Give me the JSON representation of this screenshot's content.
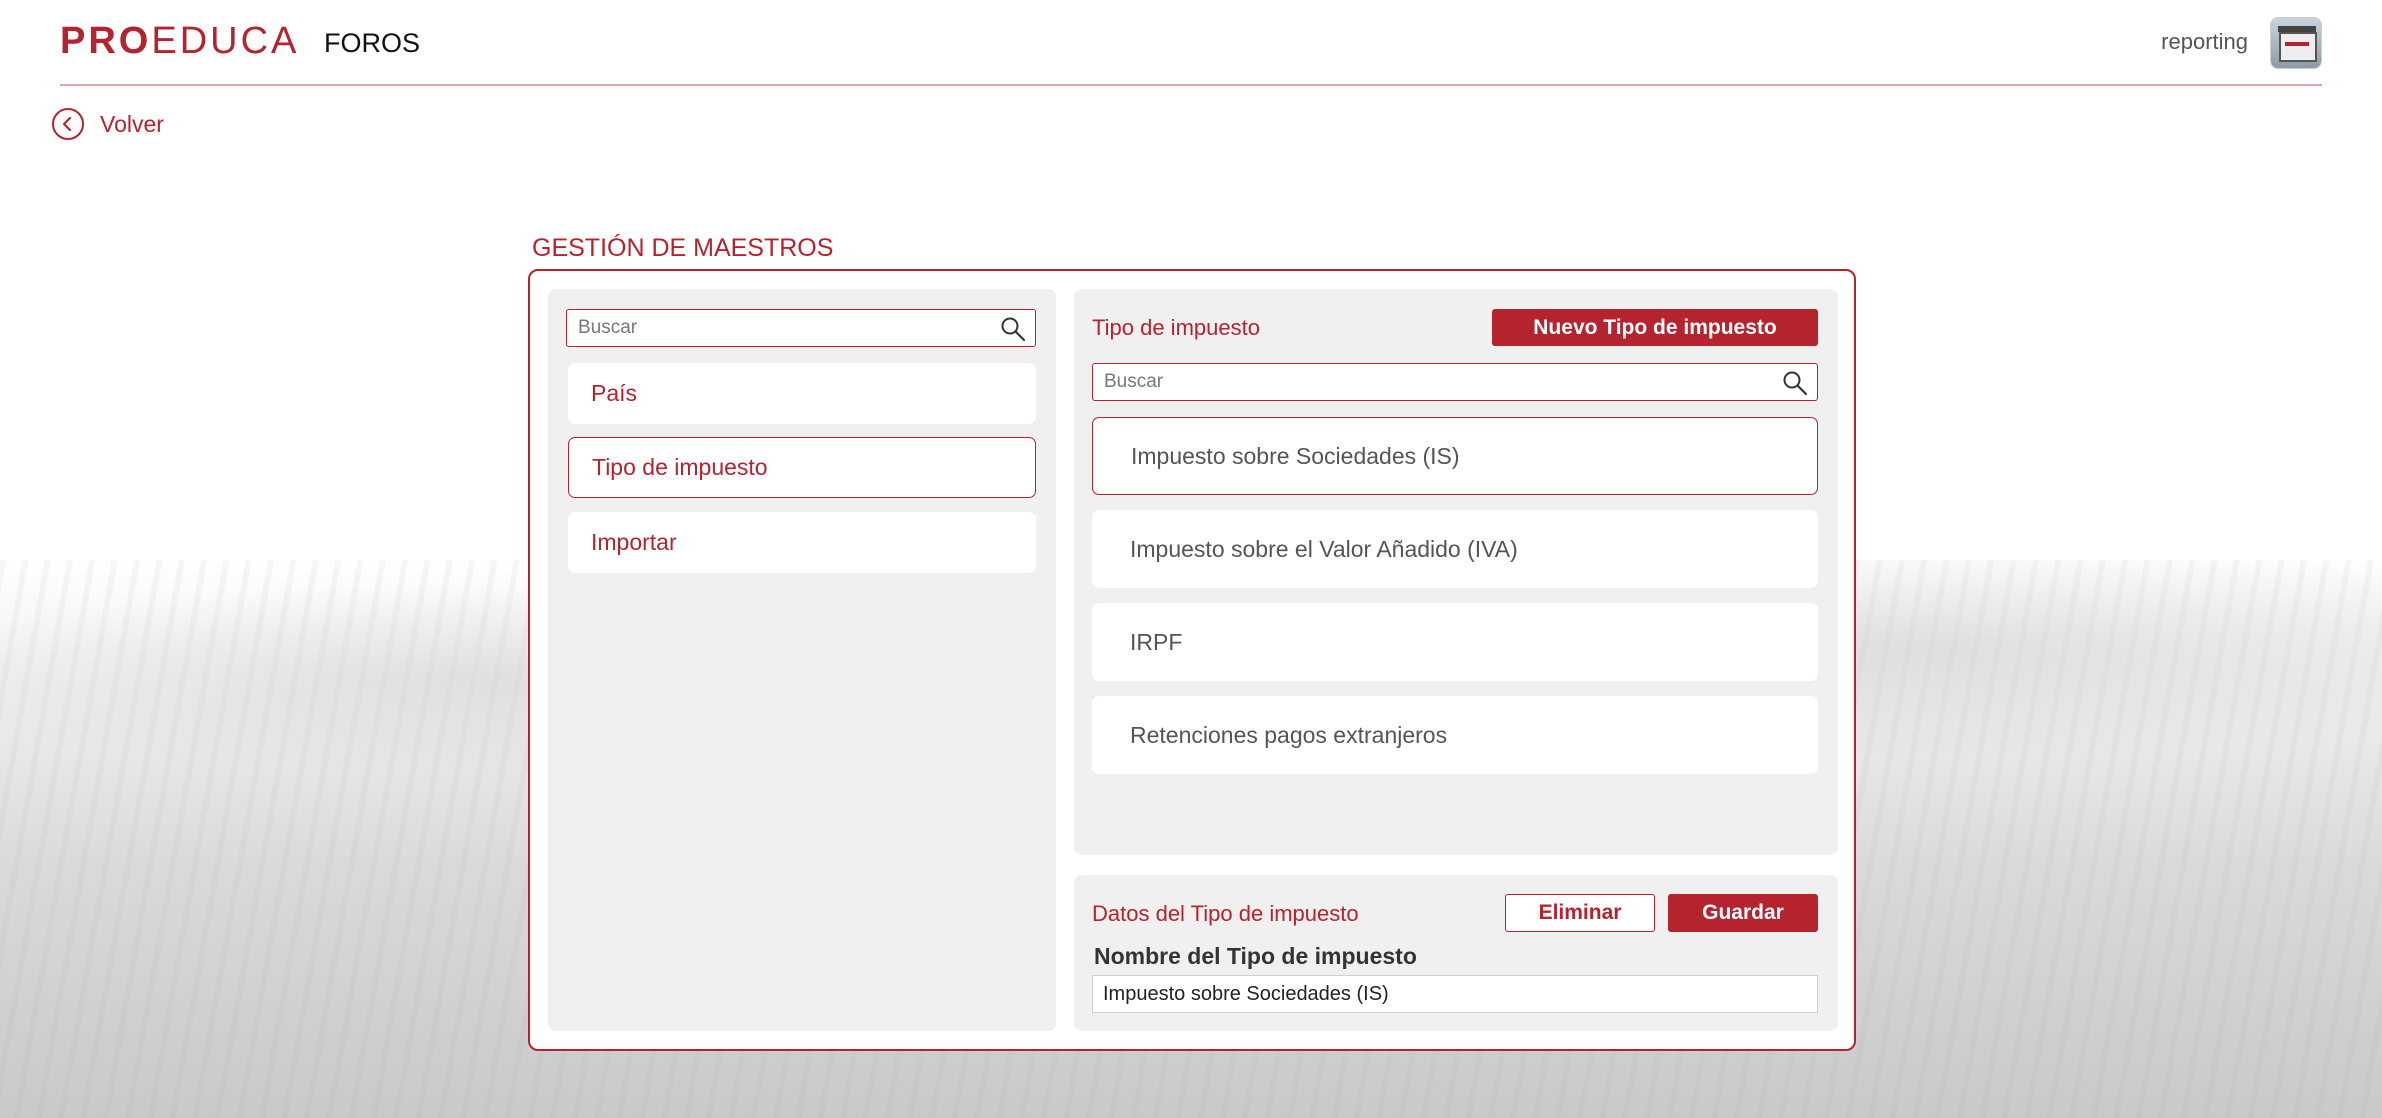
{
  "header": {
    "logo_pro": "PRO",
    "logo_educa": "EDUCA",
    "app_name": "FOROS",
    "username": "reporting"
  },
  "nav": {
    "back_label": "Volver"
  },
  "page": {
    "title": "GESTIÓN DE MAESTROS"
  },
  "left_panel": {
    "search_placeholder": "Buscar",
    "items": [
      {
        "label": "País",
        "active": false
      },
      {
        "label": "Tipo de impuesto",
        "active": true
      },
      {
        "label": "Importar",
        "active": false
      }
    ]
  },
  "list_panel": {
    "title": "Tipo de impuesto",
    "new_button_label": "Nuevo Tipo de impuesto",
    "search_placeholder": "Buscar",
    "items": [
      {
        "label": "Impuesto sobre Sociedades (IS)",
        "active": true
      },
      {
        "label": "Impuesto sobre el Valor Añadido (IVA)",
        "active": false
      },
      {
        "label": "IRPF",
        "active": false
      },
      {
        "label": "Retenciones pagos extranjeros",
        "active": false
      }
    ]
  },
  "detail_panel": {
    "title": "Datos del Tipo de impuesto",
    "delete_label": "Eliminar",
    "save_label": "Guardar",
    "field_label": "Nombre del Tipo de impuesto",
    "field_value": "Impuesto sobre Sociedades (IS)"
  },
  "colors": {
    "accent": "#b5232f",
    "panel_bg": "#f0f0f0",
    "text_gray": "#555555"
  }
}
